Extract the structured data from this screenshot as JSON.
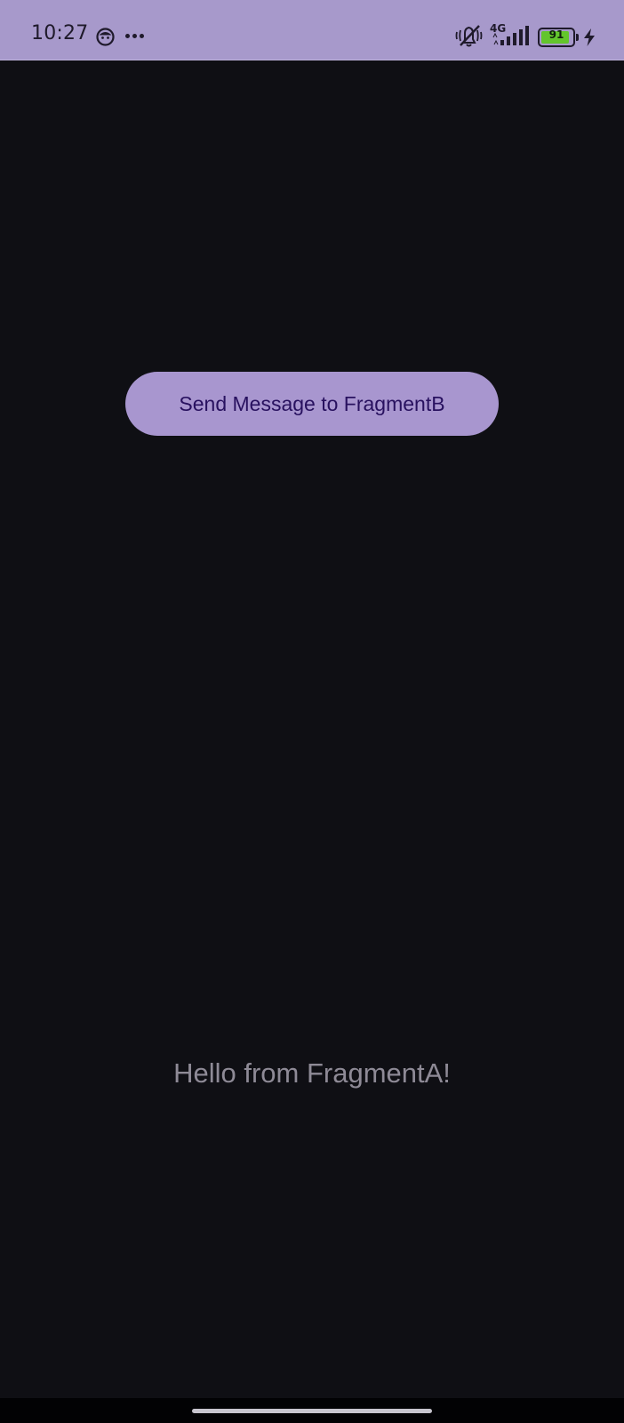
{
  "status_bar": {
    "time": "10:27",
    "network_type": "4G",
    "battery_percent": "91",
    "battery_level": 0.91,
    "background_color": "#a799cb",
    "icons": {
      "app": "face-icon",
      "more": "more-icon",
      "mute": "mute-icon",
      "signal": "signal-icon",
      "battery": "battery-icon",
      "charging": "charging-bolt-icon"
    }
  },
  "main": {
    "send_button_label": "Send Message to FragmentB",
    "message_text": "Hello from FragmentA!",
    "background_color": "#0f0f14",
    "button_color": "#a896cf"
  },
  "nav_bar": {
    "home_indicator_color": "#c7c5ce"
  }
}
